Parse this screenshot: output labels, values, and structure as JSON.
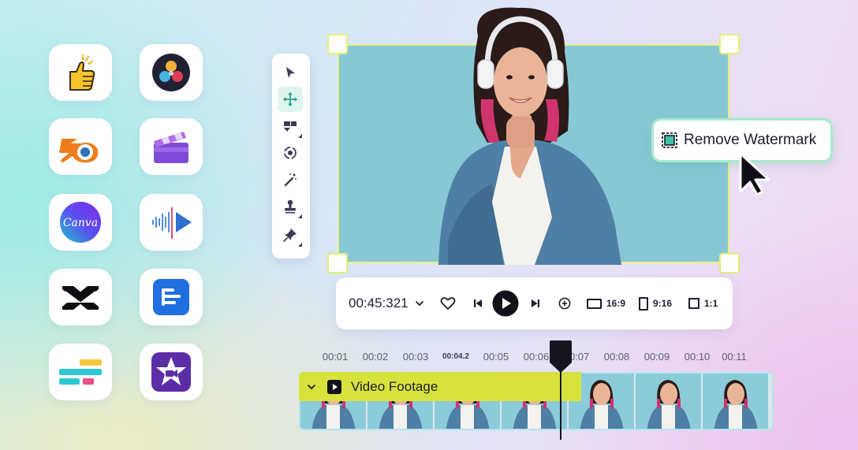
{
  "apps": [
    {
      "name": "thumbs-up-app",
      "icon": "thumbs-up-icon"
    },
    {
      "name": "davinci-resolve-app",
      "icon": "davinci-resolve-icon"
    },
    {
      "name": "blender-app",
      "icon": "blender-icon"
    },
    {
      "name": "clapperboard-app",
      "icon": "clapperboard-icon"
    },
    {
      "name": "canva-app",
      "icon": "canva-icon",
      "label": "Canva"
    },
    {
      "name": "audio-video-app",
      "icon": "audio-waveform-play-icon"
    },
    {
      "name": "capcut-app",
      "icon": "capcut-icon"
    },
    {
      "name": "document-app",
      "icon": "document-lines-icon"
    },
    {
      "name": "bars-app",
      "icon": "color-bars-icon"
    },
    {
      "name": "imovie-app",
      "icon": "imovie-star-icon"
    }
  ],
  "toolbar": {
    "tools": [
      "select-arrow-icon",
      "move-icon",
      "crop-shapes-icon",
      "rotate-target-icon",
      "magic-wand-icon",
      "stamp-icon",
      "pin-icon"
    ],
    "active_tool": "move-icon"
  },
  "watermark_button": {
    "label": "Remove Watermark",
    "icon": "watermark-frame-icon"
  },
  "playback": {
    "time": "00:45:321",
    "ratios": [
      {
        "label": "16:9"
      },
      {
        "label": "9:16"
      },
      {
        "label": "1:1"
      }
    ]
  },
  "timeline": {
    "ticks": [
      "00:01",
      "00:02",
      "00:03",
      "00:04.2",
      "00:05",
      "00:06",
      "00:07",
      "00:08",
      "00:09",
      "00:10",
      "00:11"
    ],
    "current_tick": "00:04.2",
    "clip_title": "Video Footage"
  },
  "colors": {
    "accent_yellow": "#d7e33c",
    "handle_border": "#e4ee76",
    "active_tool_bg": "#dff4ef",
    "watermark_border": "#a7ebcc",
    "preview_bg": "#88c8d6"
  }
}
